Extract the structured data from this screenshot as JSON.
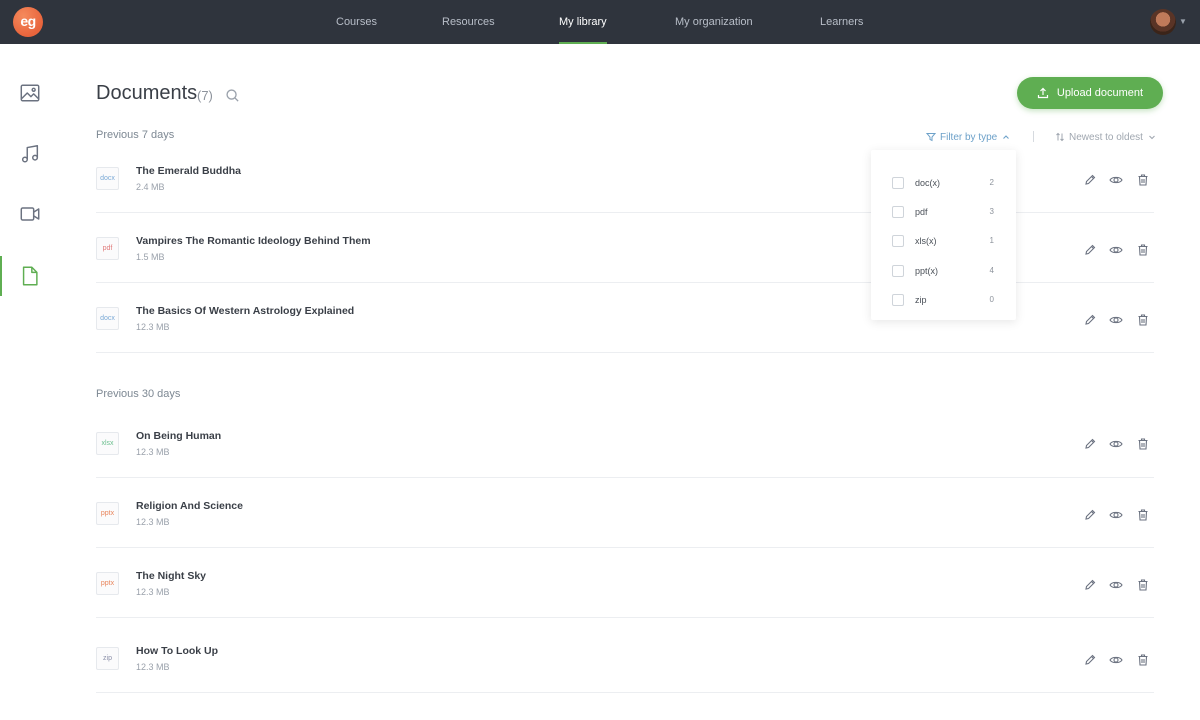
{
  "nav": {
    "logo": "eg",
    "items": [
      "Courses",
      "Resources",
      "My library",
      "My organization",
      "Learners"
    ],
    "active": "My library"
  },
  "sidebar": {
    "items": [
      {
        "icon": "image-icon",
        "label": "Images"
      },
      {
        "icon": "music-icon",
        "label": "Audio"
      },
      {
        "icon": "video-icon",
        "label": "Videos"
      },
      {
        "icon": "document-icon",
        "label": "Documents",
        "active": true
      }
    ]
  },
  "header": {
    "title": "Documents",
    "count": "(7)",
    "upload_label": "Upload document"
  },
  "sections": [
    {
      "label": "Previous 7 days",
      "docs": [
        {
          "type": "docx",
          "name": "The Emerald Buddha",
          "size": "2.4 MB"
        },
        {
          "type": "pdf",
          "name": "Vampires The Romantic Ideology Behind Them",
          "size": "1.5 MB"
        },
        {
          "type": "docx",
          "name": "The Basics Of Western Astrology Explained",
          "size": "12.3 MB"
        }
      ]
    },
    {
      "label": "Previous 30 days",
      "docs": [
        {
          "type": "xlsx",
          "name": "On Being Human",
          "size": "12.3 MB"
        },
        {
          "type": "pptx",
          "name": "Religion And Science",
          "size": "12.3 MB"
        },
        {
          "type": "pptx",
          "name": "The Night Sky",
          "size": "12.3 MB"
        },
        {
          "type": "zip",
          "name": "How To Look Up",
          "size": "12.3 MB"
        }
      ]
    }
  ],
  "filter": {
    "label": "Filter by type",
    "options": [
      {
        "label": "doc(x)",
        "count": "2"
      },
      {
        "label": "pdf",
        "count": "3"
      },
      {
        "label": "xls(x)",
        "count": "1"
      },
      {
        "label": "ppt(x)",
        "count": "4"
      },
      {
        "label": "zip",
        "count": "0"
      }
    ]
  },
  "sort": {
    "label": "Newest to oldest"
  },
  "colors": {
    "accent": "#5fae52",
    "topbar": "#2f343d",
    "filter_link": "#6da1c9",
    "docx": "#7aa9d6",
    "pdf": "#e07a7a",
    "xlsx": "#6cbf8f",
    "pptx": "#e9865d",
    "zip": "#8a8fa8"
  }
}
